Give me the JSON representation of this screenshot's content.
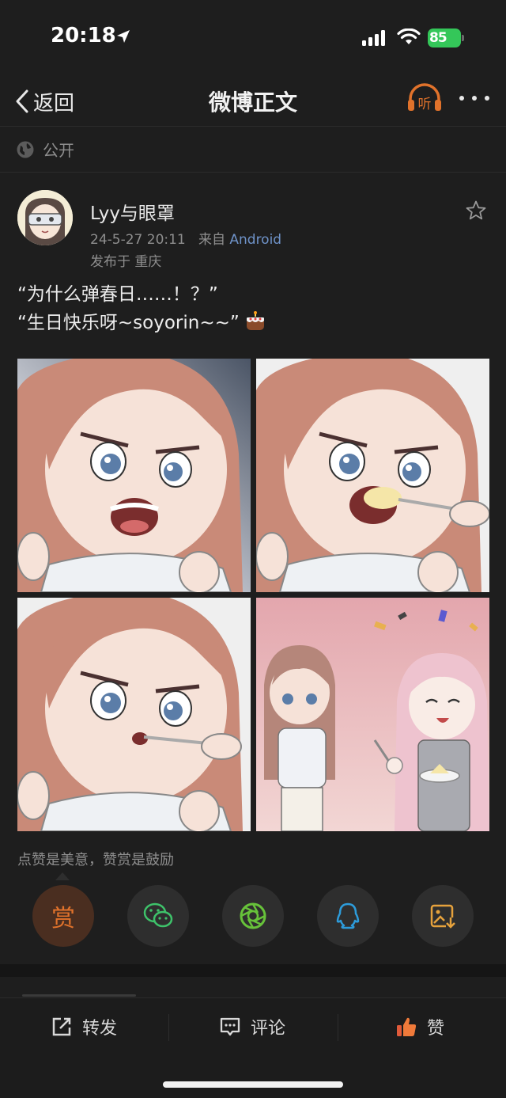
{
  "status_bar": {
    "time": "20:18",
    "battery_percent": "85",
    "battery_color": "#34c759",
    "icons": [
      "location-arrow-icon",
      "signal-icon",
      "wifi-icon",
      "battery-icon"
    ]
  },
  "nav": {
    "back_label": "返回",
    "title": "微博正文",
    "listen_label": "听",
    "accent_color": "#e0722b"
  },
  "visibility": {
    "label": "公开"
  },
  "post": {
    "username": "Lyy与眼罩",
    "timestamp": "24-5-27 20:11",
    "source_prefix": "来自",
    "source": "Android",
    "location": "发布于 重庆",
    "text_line1": "“为什么弹春日……！？”",
    "text_line2": "“生日快乐呀~soyorin~~”",
    "emoji": "cake-icon"
  },
  "images": [
    {
      "label": "comic-panel-1"
    },
    {
      "label": "comic-panel-2"
    },
    {
      "label": "comic-panel-3"
    },
    {
      "label": "comic-panel-4"
    }
  ],
  "reward": {
    "caption": "点赞是美意，赞赏是鼓励",
    "reward_label": "赏"
  },
  "share_targets": [
    "reward-icon",
    "wechat-icon",
    "moments-icon",
    "qq-icon",
    "save-image-icon"
  ],
  "bottom_bar": {
    "repost_label": "转发",
    "comment_label": "评论",
    "like_label": "赞"
  }
}
